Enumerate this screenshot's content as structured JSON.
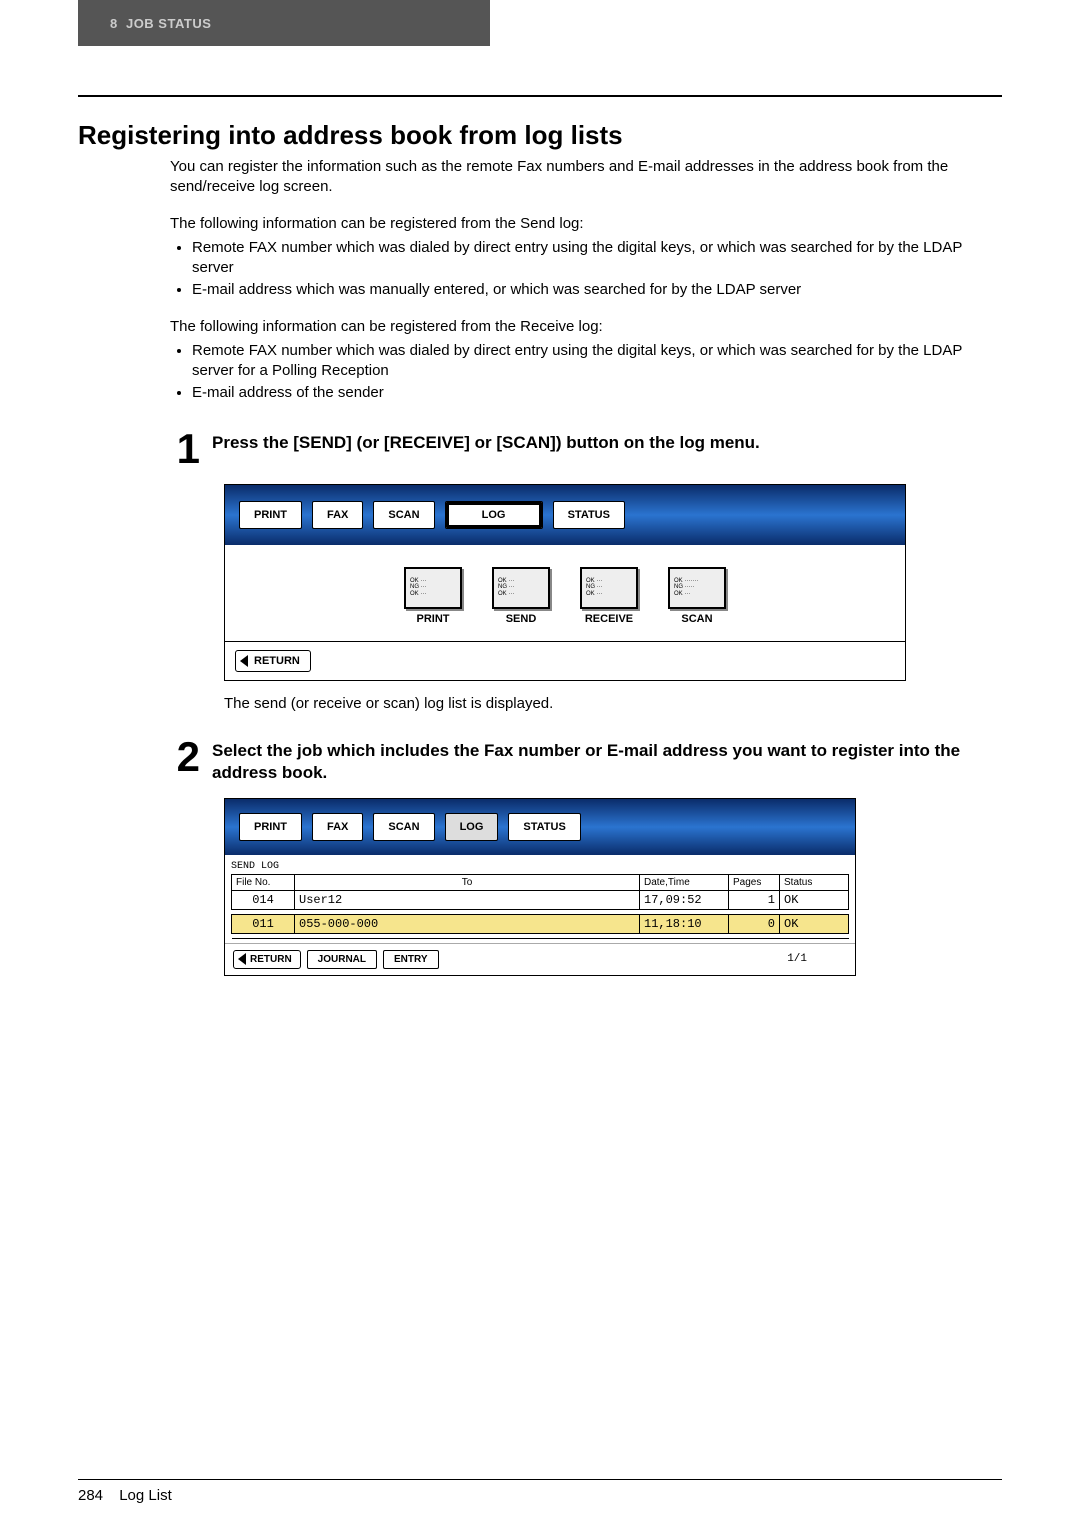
{
  "header": {
    "chapter_num": "8",
    "chapter_title": "JOB STATUS"
  },
  "section_title": "Registering into address book from log lists",
  "intro_p1": "You can register the information such as the remote Fax numbers and E-mail addresses in the address book from the send/receive log screen.",
  "intro_p2": "The following information can be registered from the Send log:",
  "send_bullets": [
    "Remote FAX number which was dialed by direct entry using the digital keys, or which was searched for by the LDAP server",
    "E-mail address which was manually entered, or which was searched for by the LDAP server"
  ],
  "intro_p3": "The following information can be registered from the Receive log:",
  "recv_bullets": [
    "Remote FAX number which was dialed by direct entry using the digital keys, or which was searched for by the LDAP server for a Polling Reception",
    "E-mail address of the sender"
  ],
  "step1": {
    "num": "1",
    "text": "Press the [SEND] (or [RECEIVE] or [SCAN]) button on the log menu.",
    "panel_tabs": {
      "print": "PRINT",
      "fax": "FAX",
      "scan": "SCAN",
      "log": "LOG",
      "status": "STATUS"
    },
    "log_items": {
      "print": "PRINT",
      "send": "SEND",
      "receive": "RECEIVE",
      "scan": "SCAN"
    },
    "return_label": "RETURN",
    "followup": "The send (or receive or scan) log list is displayed."
  },
  "step2": {
    "num": "2",
    "text": "Select the job which includes the Fax number or E-mail address you want to register into the address book.",
    "panel_tabs": {
      "print": "PRINT",
      "fax": "FAX",
      "scan": "SCAN",
      "log": "LOG",
      "status": "STATUS"
    },
    "list_label": "SEND LOG",
    "columns": {
      "file": "File No.",
      "to": "To",
      "datetime": "Date,Time",
      "pages": "Pages",
      "status": "Status"
    },
    "rows": [
      {
        "file": "014",
        "to": "User12",
        "datetime": "17,09:52",
        "pages": "1",
        "status": "OK"
      },
      {
        "file": "011",
        "to": "055-000-000",
        "datetime": "11,18:10",
        "pages": "0",
        "status": "OK"
      }
    ],
    "buttons": {
      "return": "RETURN",
      "journal": "JOURNAL",
      "entry": "ENTRY"
    },
    "pagecount": "1/1"
  },
  "footer": {
    "page": "284",
    "title": "Log List"
  }
}
